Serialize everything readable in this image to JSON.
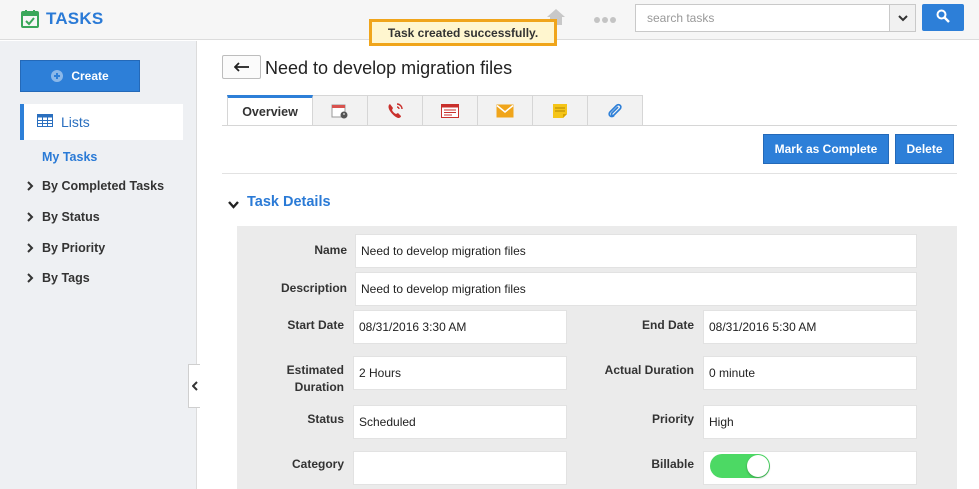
{
  "app": {
    "title": "TASKS"
  },
  "search": {
    "placeholder": "search tasks"
  },
  "toast": {
    "message": "Task created successfully."
  },
  "sidebar": {
    "create_label": "Create",
    "lists_label": "Lists",
    "my_tasks": "My Tasks",
    "filters": [
      {
        "label": "By Completed Tasks"
      },
      {
        "label": "By Status"
      },
      {
        "label": "By Priority"
      },
      {
        "label": "By Tags"
      }
    ]
  },
  "page": {
    "title": "Need to develop migration files"
  },
  "tabs": {
    "overview": "Overview",
    "icons": [
      "calendar-icon",
      "phone-icon",
      "notes-icon",
      "email-icon",
      "sticky-note-icon",
      "attachment-icon"
    ]
  },
  "actions": {
    "complete": "Mark as Complete",
    "delete": "Delete"
  },
  "section": {
    "title": "Task Details"
  },
  "fields": {
    "name": {
      "label": "Name",
      "value": "Need to develop migration files"
    },
    "description": {
      "label": "Description",
      "value": "Need to develop migration files"
    },
    "start_date": {
      "label": "Start Date",
      "value": "08/31/2016 3:30 AM"
    },
    "end_date": {
      "label": "End Date",
      "value": "08/31/2016 5:30 AM"
    },
    "estimated_duration": {
      "label_line1": "Estimated",
      "label_line2": "Duration",
      "value": "2 Hours"
    },
    "actual_duration": {
      "label": "Actual Duration",
      "value": "0 minute"
    },
    "status": {
      "label": "Status",
      "value": "Scheduled"
    },
    "priority": {
      "label": "Priority",
      "value": "High"
    },
    "category": {
      "label": "Category",
      "value": ""
    },
    "billable": {
      "label": "Billable",
      "on": true
    }
  },
  "colors": {
    "accent": "#2d7fd8",
    "toast_border": "#f0a51b",
    "toggle_on": "#4cd964"
  }
}
